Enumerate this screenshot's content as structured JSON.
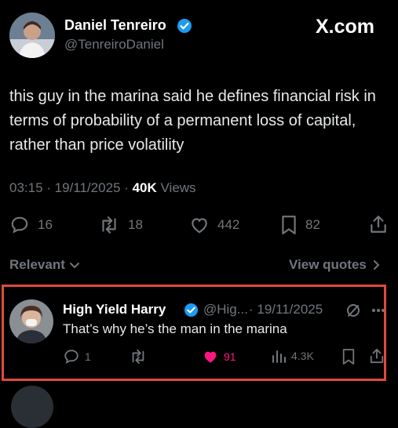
{
  "header": {
    "display_name": "Daniel Tenreiro",
    "handle": "@TenreiroDaniel",
    "site_logo": "X.com"
  },
  "post": {
    "text": "this guy in the marina said he defines financial risk in terms of probability of a permanent loss of capital, rather than price volatility",
    "time": "03:15",
    "date": "19/11/2025",
    "views_count": "40K",
    "views_label": "Views",
    "replies": "16",
    "reposts": "18",
    "likes": "442",
    "bookmarks": "82"
  },
  "filter_bar": {
    "relevant_label": "Relevant",
    "view_quotes_label": "View quotes"
  },
  "reply": {
    "display_name": "High Yield Harry",
    "handle_truncated": "@Hig...",
    "date": "· 19/11/2025",
    "text": "That’s why he’s the man in the marina",
    "replies": "1",
    "likes": "91",
    "views": "4.3K"
  },
  "colors": {
    "verified_blue": "#1d9bf0",
    "like_pink": "#f91880",
    "highlight_border": "#e0493f",
    "muted_gray": "#71767b"
  },
  "icons": [
    "verified-badge-icon",
    "reply-icon",
    "repost-icon",
    "like-icon",
    "bookmark-icon",
    "share-icon",
    "chevron-down-icon",
    "chevron-right-icon",
    "grok-icon",
    "more-icon",
    "views-icon"
  ]
}
